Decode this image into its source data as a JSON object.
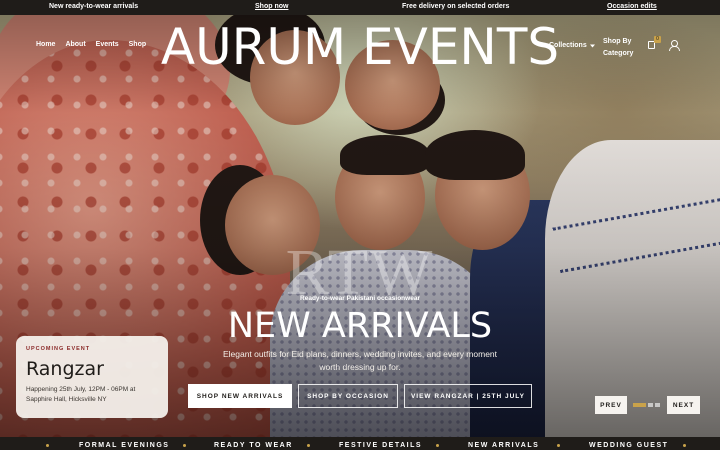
{
  "announcement": {
    "left": "New ready-to-wear arrivals",
    "shop_now": "Shop now",
    "center": "Free delivery on selected orders",
    "right": "Occasion edits"
  },
  "nav": {
    "left_items": [
      "Home",
      "About",
      "Events",
      "Shop"
    ],
    "brand": "AURUM EVENTS",
    "collections": "Collections",
    "shop_by_category_line1": "Shop By",
    "shop_by_category_line2": "Category",
    "cart_count": "0"
  },
  "hero": {
    "watermark": "RTW",
    "kicker": "Ready-to-wear Pakistani occasionwear",
    "headline": "NEW ARRIVALS",
    "subtext": "Elegant outfits for Eid plans, dinners, wedding invites, and every moment worth dressing up for.",
    "buttons": {
      "primary": "SHOP NEW ARRIVALS",
      "occasion": "SHOP BY OCCASION",
      "rangzar": "VIEW RANGZAR | 25TH JULY"
    }
  },
  "event_card": {
    "kicker": "UPCOMING EVENT",
    "title": "Rangzar",
    "detail": "Happening 25th July, 12PM - 06PM at Sapphire Hall, Hicksville NY"
  },
  "slider": {
    "prev": "PREV",
    "next": "NEXT",
    "active_slide": 1,
    "slide_count": 3,
    "accent_color": "#c9a24a"
  },
  "marquee": [
    "FORMAL EVENINGS",
    "READY TO WEAR",
    "FESTIVE DETAILS",
    "NEW ARRIVALS",
    "WEDDING GUEST"
  ],
  "icons": {
    "collections_chevron": "chevron-down-icon",
    "bag": "shopping-bag-icon",
    "user": "user-icon"
  }
}
